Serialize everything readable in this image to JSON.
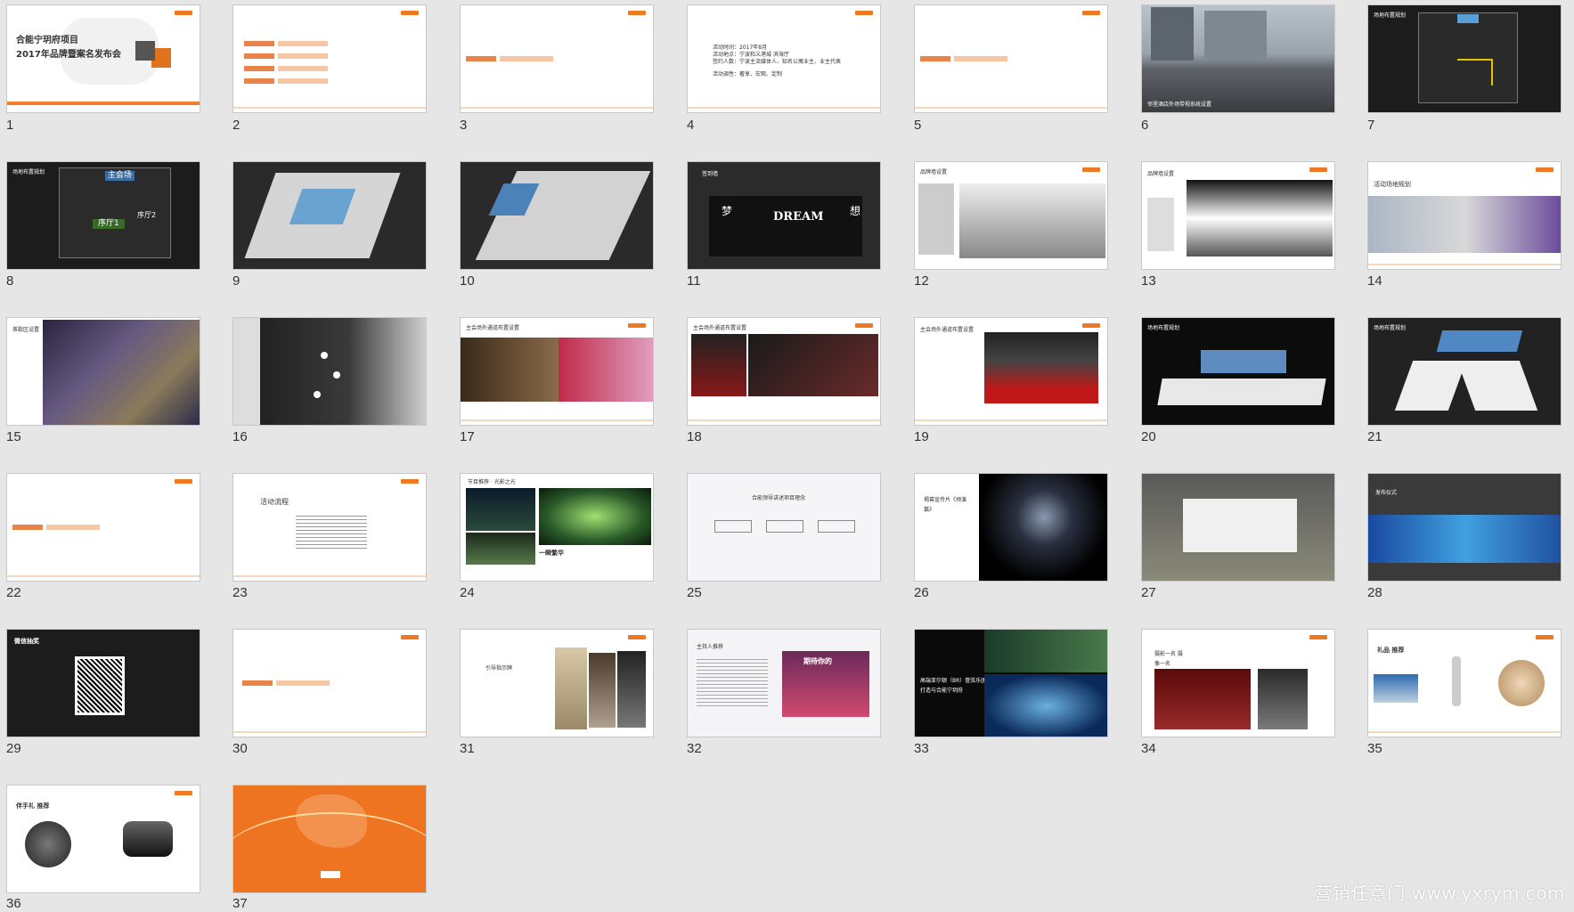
{
  "slides": [
    "1",
    "2",
    "3",
    "4",
    "5",
    "6",
    "7",
    "8",
    "9",
    "10",
    "11",
    "12",
    "13",
    "14",
    "15",
    "16",
    "17",
    "18",
    "19",
    "20",
    "21",
    "22",
    "23",
    "24",
    "25",
    "26",
    "27",
    "28",
    "29",
    "30",
    "31",
    "32",
    "33",
    "34",
    "35",
    "36",
    "37"
  ],
  "s1": {
    "line1": "合能宁玥府项目",
    "line2": "2017年品牌暨案名发布会"
  },
  "s4": {
    "lines": [
      "活动时间：2017年8月",
      "活动地点：宁波和义港城 滨海厅",
      "签约人数：宁波主流媒体人、知名公寓业主、业主代表",
      "活动调性：奢享、宏观、定制"
    ]
  },
  "s6": {
    "caption": "邻里酒店外场带视系统设置"
  },
  "s7": {
    "title": "场地布置规划"
  },
  "s8": {
    "title": "场地布置规划",
    "main": "主会场",
    "hall1": "序厅1",
    "hall2": "序厅2"
  },
  "s11": {
    "title": "签到墙",
    "dream": "DREAM",
    "left": "梦",
    "right": "想"
  },
  "s12": {
    "title": "品牌墙设置"
  },
  "s13": {
    "title": "品牌墙设置"
  },
  "s14": {
    "title": "活动场地规划"
  },
  "s15": {
    "title": "茶歇区设置"
  },
  "s17": {
    "title": "主会场外通道布置设置"
  },
  "s18": {
    "title": "主会场外通道布置设置"
  },
  "s19": {
    "title": "主会场外通道布置设置"
  },
  "s20": {
    "title": "场地布置规划"
  },
  "s21": {
    "title": "场地布置规划"
  },
  "s23": {
    "title": "活动流程"
  },
  "s24": {
    "title": "节目推荐 · 光影之光",
    "sub": "一瞬繁华"
  },
  "s25": {
    "title": "合能领导讲述项目理念"
  },
  "s26": {
    "title": "揭幕宣传片《预演篇》"
  },
  "s28": {
    "title": "发布仪式"
  },
  "s29": {
    "title": "微信抽奖"
  },
  "s31": {
    "title": "引导指示牌"
  },
  "s32": {
    "title": "主持人推荐",
    "poster": "期待你的"
  },
  "s33": {
    "title": "高端亚尔顿（BR）管弦乐团打造与合能宁玥府"
  },
  "s34": {
    "title": "摄影一名 摄像一名"
  },
  "s35": {
    "title": "礼品 推荐"
  },
  "s36": {
    "title": "伴手礼 推荐"
  },
  "watermark": "营销任意门 www.yxrym.com"
}
